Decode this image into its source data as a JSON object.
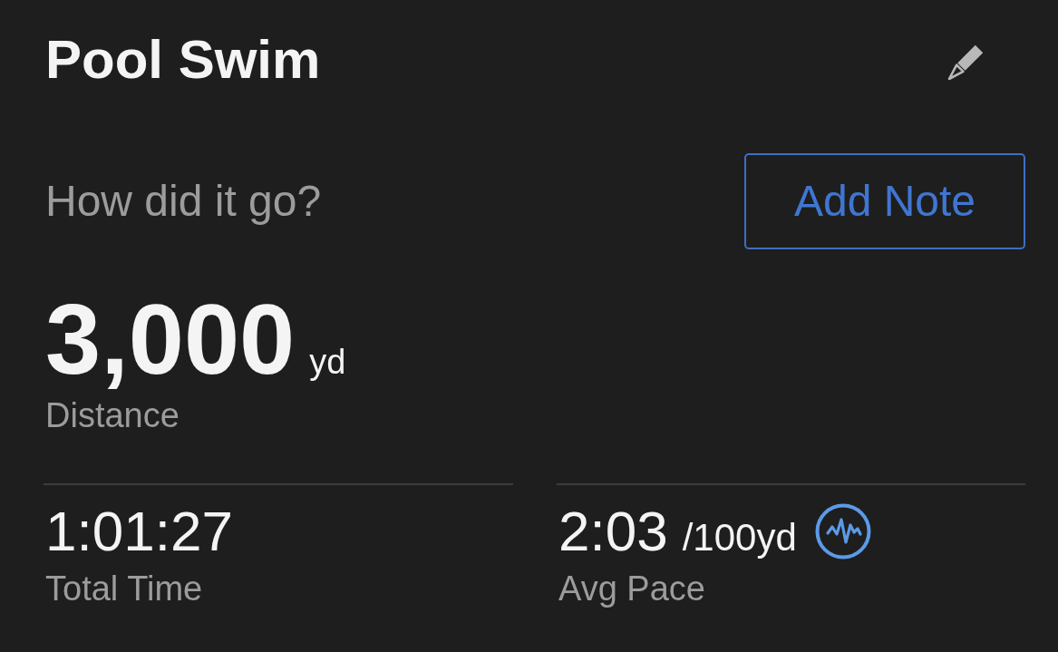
{
  "header": {
    "title": "Pool Swim"
  },
  "note_prompt": {
    "question": "How did it go?",
    "button": "Add Note"
  },
  "primary_stat": {
    "value": "3,000",
    "unit": "yd",
    "label": "Distance"
  },
  "stats": [
    {
      "kind": "plain",
      "value": "1:01:27",
      "label": "Total Time"
    },
    {
      "kind": "chart_link",
      "value": "2:03",
      "unit": "/100yd",
      "label": "Avg Pace"
    }
  ]
}
